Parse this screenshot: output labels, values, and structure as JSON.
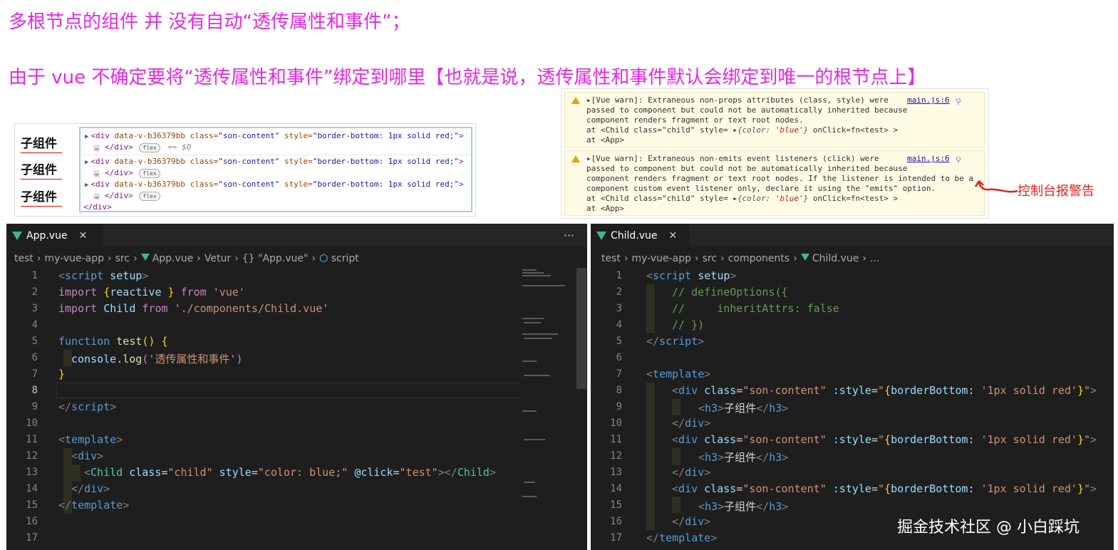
{
  "headings": {
    "line1": "多根节点的组件 并 没有自动“透传属性和事件”；",
    "line2": "由于 vue 不确定要将“透传属性和事件”绑定到哪里【也就是说，透传属性和事件默认会绑定到唯一的根节点上】"
  },
  "preview": {
    "h3_items": [
      "子组件",
      "子组件",
      "子组件"
    ],
    "devtools": {
      "div_open_tag": "<div",
      "data_attr": "data-v-b36379bb",
      "class_attr": "class=",
      "class_value": "\"son-content\"",
      "style_attr": "style=",
      "style_value": "\"border-bottom: 1px solid red;\"",
      "close_bracket": ">",
      "close_div": "</div>",
      "ellipsis": "…",
      "flex_badge": "flex",
      "selected_marker": "== $0",
      "outer_close": "</div>"
    }
  },
  "console": {
    "warnings": [
      {
        "lines": [
          "▸[Vue warn]: Extraneous non-props attributes (class, style) were",
          "passed to component but could not be automatically inherited because",
          "component renders fragment or text root nodes."
        ],
        "at_child_prefix": "  at <Child class=\"child\" style= ",
        "obj_open": "▸",
        "obj_key": "{color: ",
        "obj_val": "'blue'",
        "obj_close": "}",
        "at_child_suffix": " onClick=fn<test> >",
        "at_app": "  at <App>",
        "source": "main.js:6"
      },
      {
        "lines": [
          "▸[Vue warn]: Extraneous non-emits event listeners (click) were",
          "passed to component but could not be automatically inherited because",
          "component renders fragment or text root nodes. If the listener is intended to be a",
          "component custom event listener only, declare it using the \"emits\" option."
        ],
        "at_child_prefix": "  at <Child class=\"child\" style= ",
        "obj_open": "▸",
        "obj_key": "{color: ",
        "obj_val": "'blue'",
        "obj_close": "}",
        "at_child_suffix": " onClick=fn<test> >",
        "at_app": "  at <App>",
        "source": "main.js:6"
      }
    ],
    "annotation": "控制台报警告"
  },
  "editor_left": {
    "tab_label": "App.vue",
    "close": "✕",
    "more": "···",
    "breadcrumb": [
      "test",
      "my-vue-app",
      "src",
      "App.vue",
      "Vetur",
      "{} \"App.vue\"",
      "script"
    ],
    "line_numbers": [
      "1",
      "2",
      "3",
      "4",
      "5",
      "6",
      "7",
      "8",
      "9",
      "10",
      "11",
      "12",
      "13",
      "14",
      "15",
      "16",
      "17"
    ]
  },
  "editor_right": {
    "tab_label": "Child.vue",
    "close": "✕",
    "breadcrumb": [
      "test",
      "my-vue-app",
      "src",
      "components",
      "Child.vue",
      "..."
    ],
    "line_numbers": [
      "1",
      "2",
      "3",
      "4",
      "5",
      "6",
      "7",
      "8",
      "9",
      "10",
      "11",
      "12",
      "13",
      "14",
      "15",
      "16",
      "17"
    ]
  },
  "watermark": "掘金技术社区 @ 小白踩坑",
  "colors": {
    "heading": "#e627e6",
    "editor_bg": "#1e1e1e",
    "vue_green": "#41b883",
    "annotation_red": "#e02020"
  }
}
